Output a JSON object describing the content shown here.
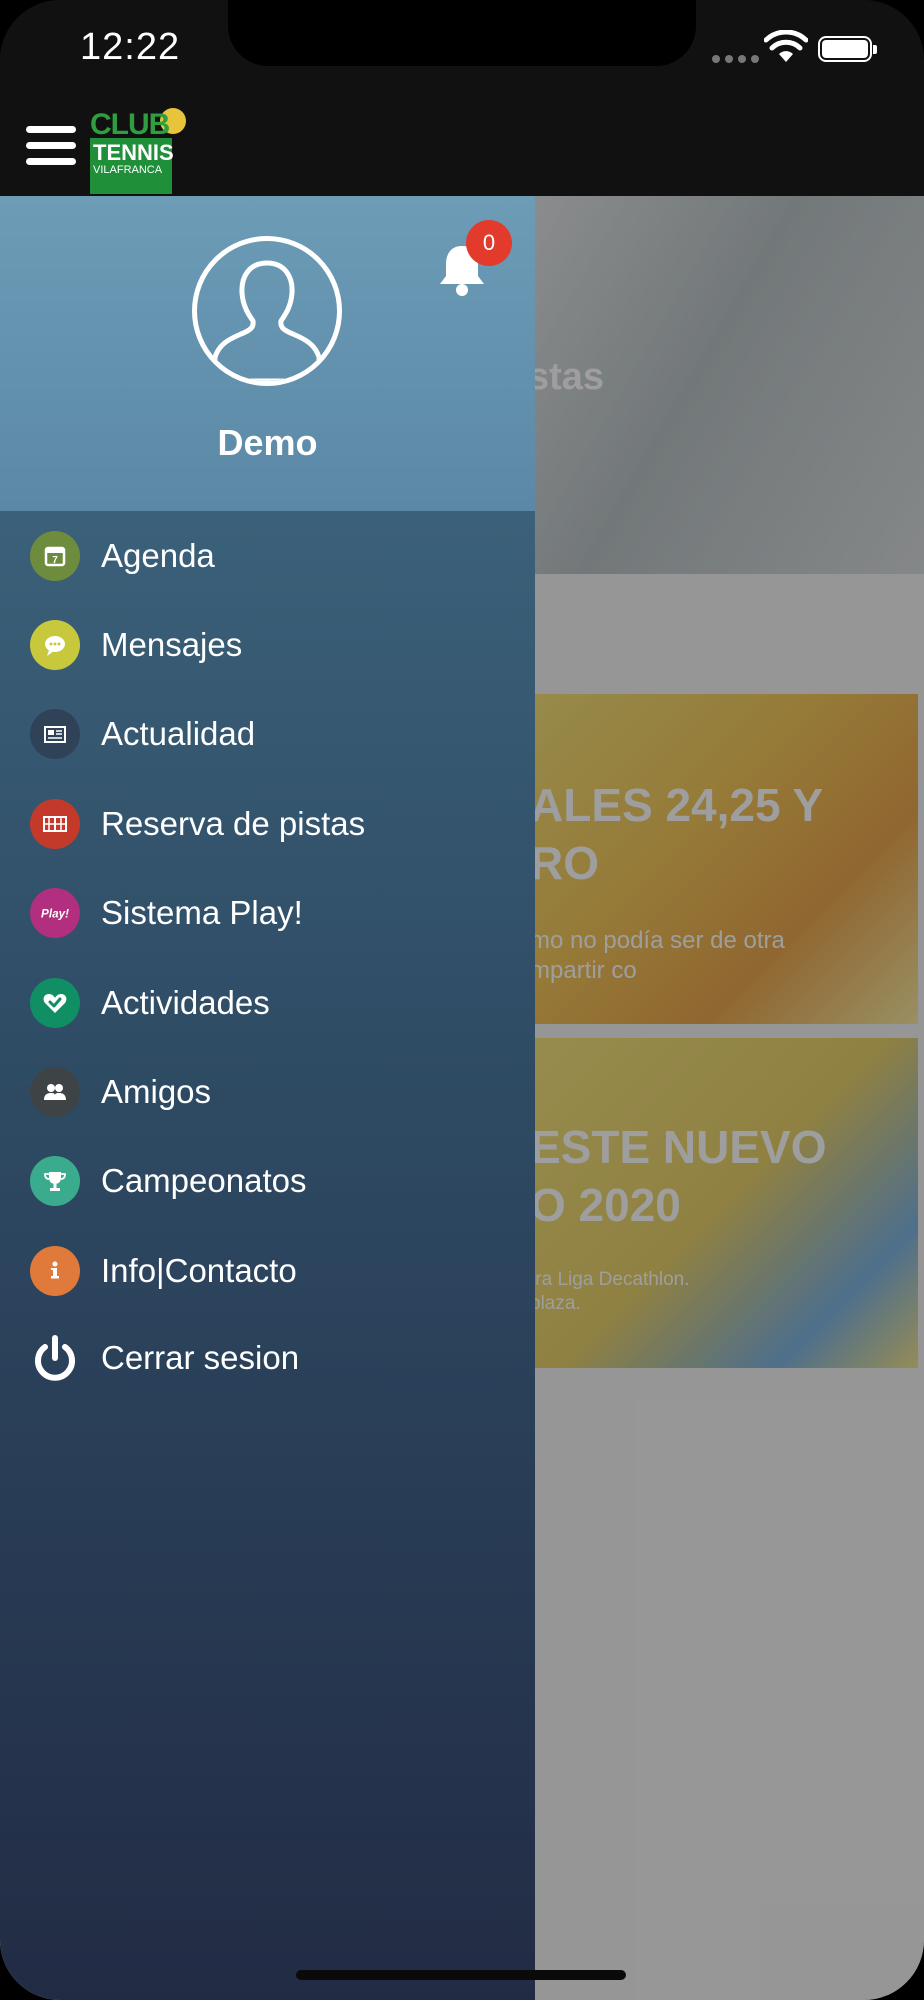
{
  "status_bar": {
    "time": "12:22"
  },
  "app": {
    "logo": {
      "line1": "CLUB",
      "line2": "TENNIS",
      "line3": "VILAFRANCA"
    }
  },
  "background": {
    "hero_title": "stas",
    "card1": {
      "title_line1": "ALES 24,25 Y",
      "title_line2": "RO",
      "text_line1": "mo no podía ser de otra",
      "text_line2": "mpartir co"
    },
    "card2": {
      "title_line1": "ESTE NUEVO",
      "title_line2": "O 2020",
      "text_line1": "tra Liga Decathlon.",
      "text_line2": "plaza."
    }
  },
  "drawer": {
    "user_name": "Demo",
    "notification_count": "0",
    "items": [
      {
        "label": "Agenda",
        "icon": "calendar-icon",
        "color": "#6e8c3e"
      },
      {
        "label": "Mensajes",
        "icon": "chat-icon",
        "color": "#c8c83c"
      },
      {
        "label": "Actualidad",
        "icon": "newspaper-icon",
        "color": "#2f4258"
      },
      {
        "label": "Reserva de pistas",
        "icon": "court-icon",
        "color": "#c43a2a"
      },
      {
        "label": "Sistema Play!",
        "icon": "play-badge-icon",
        "color": "#b12f7e"
      },
      {
        "label": "Actividades",
        "icon": "heart-check-icon",
        "color": "#0f8f63"
      },
      {
        "label": "Amigos",
        "icon": "friends-icon",
        "color": "#3e4446"
      },
      {
        "label": "Campeonatos",
        "icon": "trophy-icon",
        "color": "#3aab8c"
      },
      {
        "label": "Info|Contacto",
        "icon": "info-icon",
        "color": "#e07a3a"
      }
    ],
    "logout_label": "Cerrar sesion"
  }
}
